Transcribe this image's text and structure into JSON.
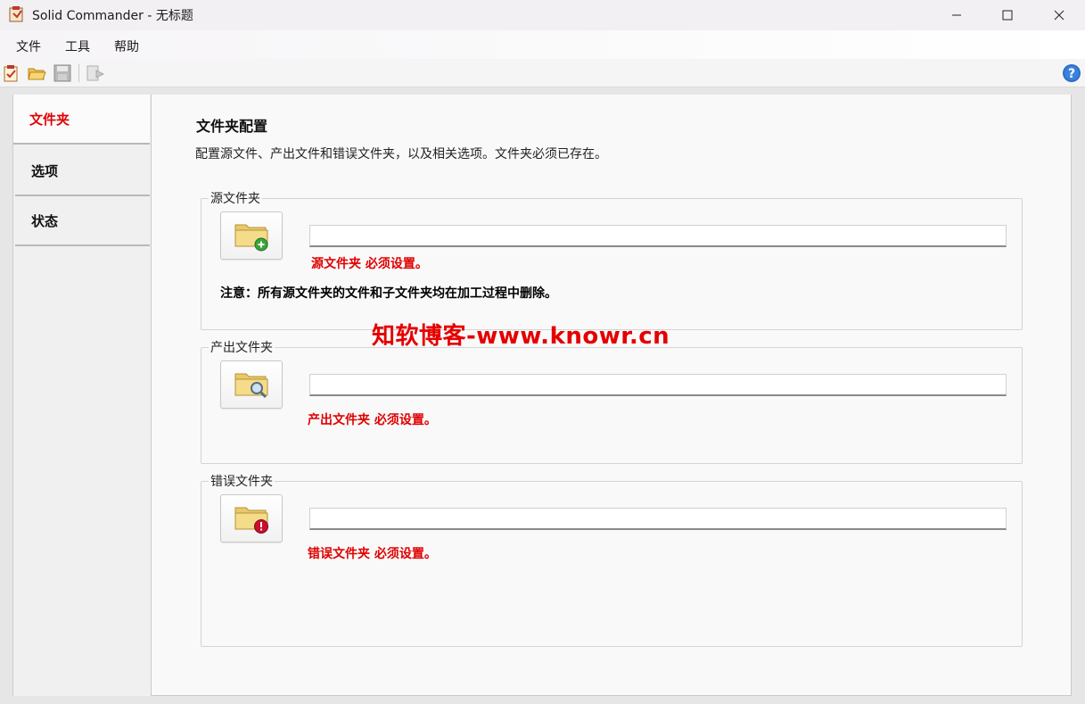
{
  "window": {
    "title": "Solid Commander - 无标题",
    "minimize_label": "—",
    "maximize_label": "☐",
    "close_label": "✕"
  },
  "menu": {
    "items": [
      "文件",
      "工具",
      "帮助"
    ]
  },
  "toolbar": {
    "buttons": [
      "new-project-icon",
      "open-folder-icon",
      "save-icon",
      "run-icon"
    ],
    "help_icon": "help-icon"
  },
  "sidebar": {
    "tabs": [
      {
        "label": "文件夹",
        "active": true
      },
      {
        "label": "选项",
        "active": false
      },
      {
        "label": "状态",
        "active": false
      }
    ]
  },
  "main": {
    "title": "文件夹配置",
    "description": "配置源文件、产出文件和错误文件夹，以及相关选项。文件夹必须已存在。",
    "source": {
      "group_title": "源文件夹",
      "value": "",
      "error": "源文件夹 必须设置。",
      "note": "注意：所有源文件夹的文件和子文件夹均在加工过程中删除。"
    },
    "output": {
      "group_title": "产出文件夹",
      "value": "",
      "error": "产出文件夹 必须设置。"
    },
    "errorfolder": {
      "group_title": "错误文件夹",
      "value": "",
      "error": "错误文件夹 必须设置。"
    }
  },
  "watermark": "知软博客-www.knowr.cn",
  "colors": {
    "error_red": "#e00000",
    "watermark_red": "#e50000"
  }
}
